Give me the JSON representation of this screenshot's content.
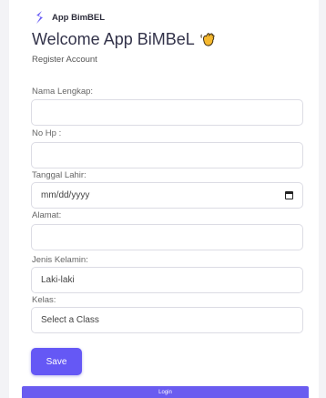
{
  "app": {
    "brand_name": "App BimBEL",
    "title": "Welcome App BiMBeL",
    "subtitle": "Register Account",
    "accent_color": "#6558f5"
  },
  "form": {
    "fields": [
      {
        "label": "Nama Lengkap:",
        "value": "",
        "placeholder": ""
      },
      {
        "label": "No Hp :",
        "value": "",
        "placeholder": ""
      },
      {
        "label": "Tanggal Lahir:",
        "value": "",
        "placeholder": "mm/dd/yyyy"
      },
      {
        "label": "Alamat:",
        "value": "",
        "placeholder": ""
      },
      {
        "label": "Jenis Kelamin:",
        "value": "Laki-laki",
        "placeholder": ""
      },
      {
        "label": "Kelas:",
        "value": "Select a Class",
        "placeholder": ""
      }
    ],
    "save_label": "Save",
    "login_label": "Login"
  },
  "icons": {
    "brand": "brand-logo-icon",
    "wave": "waving-hand-icon",
    "calendar": "calendar-icon"
  }
}
